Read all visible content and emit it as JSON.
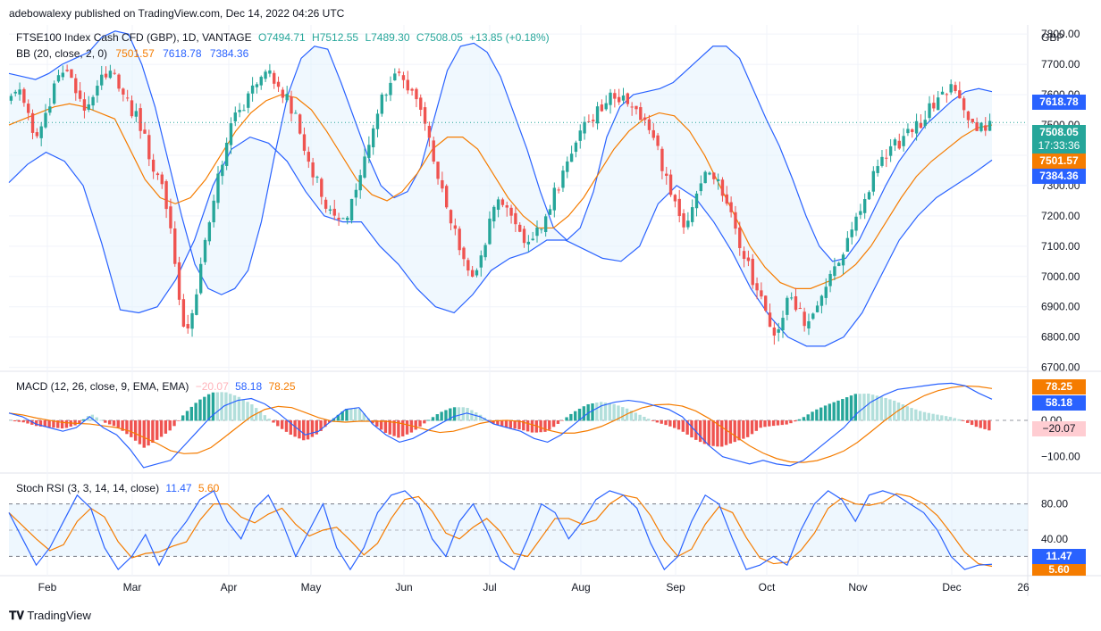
{
  "header": {
    "published": "adebowalexy published on TradingView.com, Dec 14, 2022 04:26 UTC"
  },
  "main": {
    "symbol": "FTSE100 Index Cash CFD (GBP), 1D, VANTAGE",
    "ohlc": [
      "O7494.71",
      "H7512.55",
      "L7489.30",
      "C7508.05",
      "+13.85 (+0.18%)"
    ],
    "bb_label": "BB (20, close, 2, 0)",
    "bb_values": [
      "7501.57",
      "7618.78",
      "7384.36"
    ],
    "currency": "GBP",
    "price_ticks": [
      "7800.00",
      "7700.00",
      "7600.00",
      "7500.00",
      "7400.00",
      "7300.00",
      "7200.00",
      "7100.00",
      "7000.00",
      "6900.00",
      "6800.00",
      "6700.00"
    ],
    "price_tags": [
      {
        "text": "7618.78",
        "color": "#2962ff"
      },
      {
        "text": "7508.05",
        "color": "#26a69a"
      },
      {
        "text": "17:33:36",
        "color": "#26a69a"
      },
      {
        "text": "7501.57",
        "color": "#f57c00"
      },
      {
        "text": "7384.36",
        "color": "#2962ff"
      }
    ]
  },
  "macd": {
    "label": "MACD (12, 26, close, 9, EMA, EMA)",
    "values": [
      "−20.07",
      "58.18",
      "78.25"
    ],
    "ticks": [
      "0.00",
      "−100.00"
    ],
    "tags": [
      {
        "text": "78.25",
        "color": "#f57c00",
        "fg": "#ffffff"
      },
      {
        "text": "58.18",
        "color": "#2962ff",
        "fg": "#ffffff"
      },
      {
        "text": "−20.07",
        "color": "#ffcdd2",
        "fg": "#131722"
      }
    ]
  },
  "stoch": {
    "label": "Stoch RSI (3, 3, 14, 14, close)",
    "values": [
      "11.47",
      "5.60"
    ],
    "ticks": [
      "80.00",
      "40.00"
    ],
    "tags": [
      {
        "text": "11.47",
        "color": "#2962ff"
      },
      {
        "text": "5.60",
        "color": "#f57c00"
      }
    ]
  },
  "x_axis": [
    "Feb",
    "Mar",
    "Apr",
    "May",
    "Jun",
    "Jul",
    "Aug",
    "Sep",
    "Oct",
    "Nov",
    "Dec",
    "26"
  ],
  "footer": "TradingView",
  "chart_data": {
    "type": "candlestick",
    "title": "FTSE100 Index Cash CFD (GBP), 1D, VANTAGE",
    "y_range": [
      6690,
      7830
    ],
    "price_path": [
      7590,
      7620,
      7560,
      7440,
      7500,
      7600,
      7680,
      7650,
      7600,
      7560,
      7620,
      7650,
      7680,
      7630,
      7580,
      7530,
      7460,
      7380,
      7300,
      7200,
      7000,
      6800,
      6920,
      7050,
      7200,
      7330,
      7440,
      7520,
      7570,
      7620,
      7650,
      7660,
      7640,
      7600,
      7540,
      7460,
      7380,
      7300,
      7230,
      7200,
      7180,
      7240,
      7330,
      7440,
      7530,
      7600,
      7640,
      7660,
      7620,
      7560,
      7480,
      7380,
      7280,
      7180,
      7100,
      7030,
      7000,
      7100,
      7200,
      7260,
      7220,
      7160,
      7130,
      7150,
      7180,
      7240,
      7300,
      7360,
      7420,
      7480,
      7520,
      7560,
      7590,
      7600,
      7580,
      7560,
      7520,
      7480,
      7420,
      7320,
      7230,
      7160,
      7200,
      7280,
      7360,
      7330,
      7260,
      7180,
      7100,
      7020,
      6950,
      6870,
      6810,
      6860,
      6940,
      6880,
      6840,
      6900,
      6960,
      7020,
      7060,
      7120,
      7180,
      7260,
      7330,
      7380,
      7420,
      7440,
      7460,
      7490,
      7520,
      7560,
      7600,
      7630,
      7590,
      7540,
      7490,
      7500,
      7508
    ],
    "bb_upper_path": [
      7670,
      7660,
      7650,
      7670,
      7700,
      7720,
      7740,
      7790,
      7810,
      7800,
      7700,
      7560,
      7380,
      7200,
      7040,
      6960,
      6940,
      6960,
      7020,
      7180,
      7400,
      7600,
      7720,
      7760,
      7750,
      7640,
      7520,
      7400,
      7300,
      7260,
      7280,
      7360,
      7520,
      7680,
      7760,
      7770,
      7740,
      7660,
      7540,
      7420,
      7280,
      7160,
      7120,
      7160,
      7280,
      7460,
      7560,
      7600,
      7610,
      7620,
      7640,
      7680,
      7720,
      7760,
      7760,
      7720,
      7620,
      7520,
      7430,
      7320,
      7200,
      7100,
      7050,
      7060,
      7120,
      7210,
      7300,
      7380,
      7440,
      7500,
      7540,
      7580,
      7610,
      7620,
      7610
    ],
    "bb_basis_path": [
      7500,
      7520,
      7540,
      7560,
      7570,
      7560,
      7540,
      7520,
      7420,
      7320,
      7260,
      7240,
      7260,
      7320,
      7400,
      7480,
      7540,
      7580,
      7600,
      7590,
      7550,
      7480,
      7400,
      7320,
      7270,
      7250,
      7280,
      7340,
      7420,
      7460,
      7460,
      7420,
      7340,
      7260,
      7200,
      7160,
      7160,
      7200,
      7260,
      7340,
      7420,
      7480,
      7520,
      7540,
      7530,
      7480,
      7400,
      7300,
      7200,
      7100,
      7030,
      6980,
      6960,
      6960,
      6980,
      7000,
      7040,
      7100,
      7180,
      7260,
      7330,
      7380,
      7420,
      7460,
      7490,
      7500
    ],
    "bb_lower_path": [
      7310,
      7370,
      7410,
      7380,
      7300,
      7110,
      6890,
      6880,
      6900,
      6990,
      7120,
      7300,
      7420,
      7460,
      7440,
      7380,
      7280,
      7200,
      7180,
      7180,
      7100,
      7040,
      6960,
      6900,
      6880,
      6940,
      7020,
      7060,
      7080,
      7120,
      7120,
      7090,
      7060,
      7050,
      7100,
      7240,
      7300,
      7260,
      7180,
      7080,
      6960,
      6870,
      6800,
      6770,
      6770,
      6800,
      6880,
      7000,
      7120,
      7200,
      7260,
      7300,
      7340,
      7384
    ]
  }
}
